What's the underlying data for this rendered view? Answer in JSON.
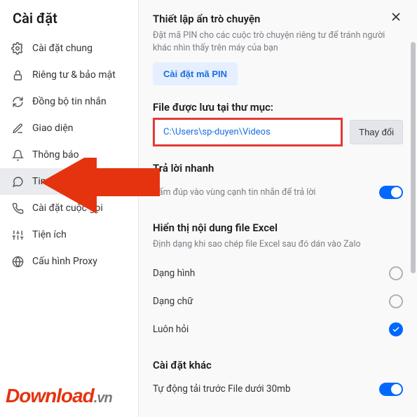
{
  "title": "Cài đặt",
  "sidebar": {
    "items": [
      {
        "label": "Cài đặt chung",
        "icon": "gear"
      },
      {
        "label": "Riêng tư & bảo mật",
        "icon": "lock"
      },
      {
        "label": "Đồng bộ tin nhắn",
        "icon": "refresh"
      },
      {
        "label": "Giao diện",
        "icon": "edit"
      },
      {
        "label": "Thông báo",
        "icon": "bell"
      },
      {
        "label": "Tin nhắn",
        "icon": "message"
      },
      {
        "label": "Cài đặt cuộc gọi",
        "icon": "phone"
      },
      {
        "label": "Tiện ích",
        "icon": "sliders"
      },
      {
        "label": "Cấu hình Proxy",
        "icon": "globe"
      }
    ]
  },
  "hidden_chat": {
    "title": "Thiết lập ẩn trò chuyện",
    "desc": "Đặt mã PIN cho các cuộc trò chuyện riêng tư để tránh người khác nhìn thấy trên máy của bạn",
    "button": "Cài đặt mã PIN"
  },
  "file_location": {
    "title": "File được lưu tại thư mục:",
    "path": "C:\\Users\\sp-duyen\\Videos",
    "change": "Thay đổi"
  },
  "quick_reply": {
    "title": "Trả lời nhanh",
    "desc": "Bấm đúp vào vùng cạnh tin nhắn để trả lời"
  },
  "excel": {
    "title": "Hiển thị nội dung file Excel",
    "desc": "Định dạng khi sao chép file Excel sau đó dán vào Zalo",
    "opt_image": "Dạng hình",
    "opt_text": "Dạng chữ",
    "opt_ask": "Luôn hỏi"
  },
  "other": {
    "title": "Cài đặt khác",
    "preload": "Tự động tải trước File dưới 30mb"
  },
  "watermark": {
    "main": "Download",
    "suffix": ".vn"
  }
}
